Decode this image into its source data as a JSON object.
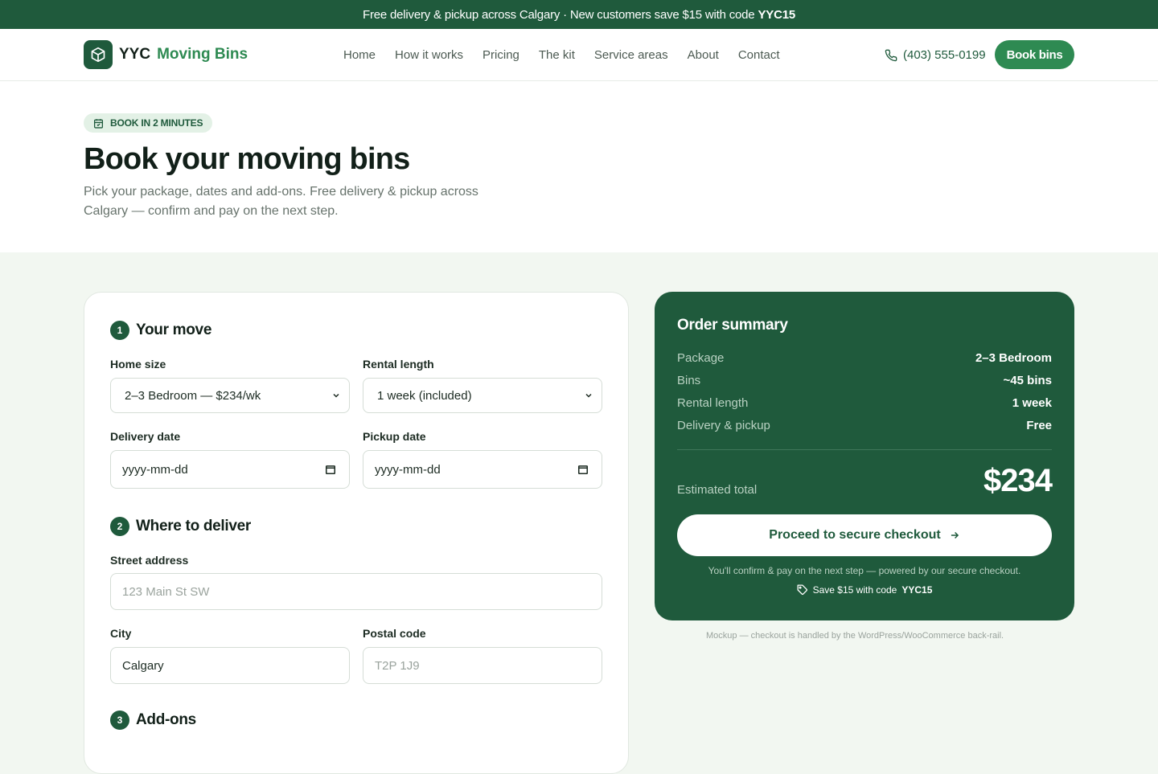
{
  "announcement": {
    "text": "Free delivery & pickup across Calgary · New customers save $15 with code",
    "code": "YYC15"
  },
  "brand": {
    "prefix": "YYC",
    "name": "Moving Bins"
  },
  "nav": {
    "links": [
      "Home",
      "How it works",
      "Pricing",
      "The kit",
      "Service areas",
      "About",
      "Contact"
    ],
    "phone": "(403) 555-0199",
    "cta": "Book bins"
  },
  "hero": {
    "badge": "BOOK IN 2 MINUTES",
    "title": "Book your moving bins",
    "subtitle": "Pick your package, dates and add-ons. Free delivery & pickup across Calgary — confirm and pay on the next step."
  },
  "form": {
    "step1": {
      "num": "1",
      "title": "Your move"
    },
    "home_size": {
      "label": "Home size",
      "value": "2–3 Bedroom — $234/wk"
    },
    "rental_length": {
      "label": "Rental length",
      "value": "1 week (included)"
    },
    "delivery_date": {
      "label": "Delivery date",
      "value": "yyyy-mm-dd"
    },
    "pickup_date": {
      "label": "Pickup date",
      "value": "yyyy-mm-dd"
    },
    "step2": {
      "num": "2",
      "title": "Where to deliver"
    },
    "street": {
      "label": "Street address",
      "placeholder": "123 Main St SW"
    },
    "city": {
      "label": "City",
      "value": "Calgary"
    },
    "postal": {
      "label": "Postal code",
      "placeholder": "T2P 1J9"
    },
    "step3": {
      "num": "3",
      "title": "Add-ons"
    }
  },
  "summary": {
    "title": "Order summary",
    "rows": [
      {
        "k": "Package",
        "v": "2–3 Bedroom"
      },
      {
        "k": "Bins",
        "v": "~45 bins"
      },
      {
        "k": "Rental length",
        "v": "1 week"
      },
      {
        "k": "Delivery & pickup",
        "v": "Free"
      }
    ],
    "total_label": "Estimated total",
    "total": "$234",
    "cta": "Proceed to secure checkout",
    "note": "You'll confirm & pay on the next step — powered by our secure checkout.",
    "promo_text": "Save $15 with code",
    "promo_code": "YYC15"
  },
  "footnote": "Mockup — checkout is handled by the WordPress/WooCommerce back-rail.",
  "colors": {
    "brand_dark": "#1f5a3c",
    "brand_accent": "#2e8a52",
    "page_bg": "#f2f7f1"
  }
}
